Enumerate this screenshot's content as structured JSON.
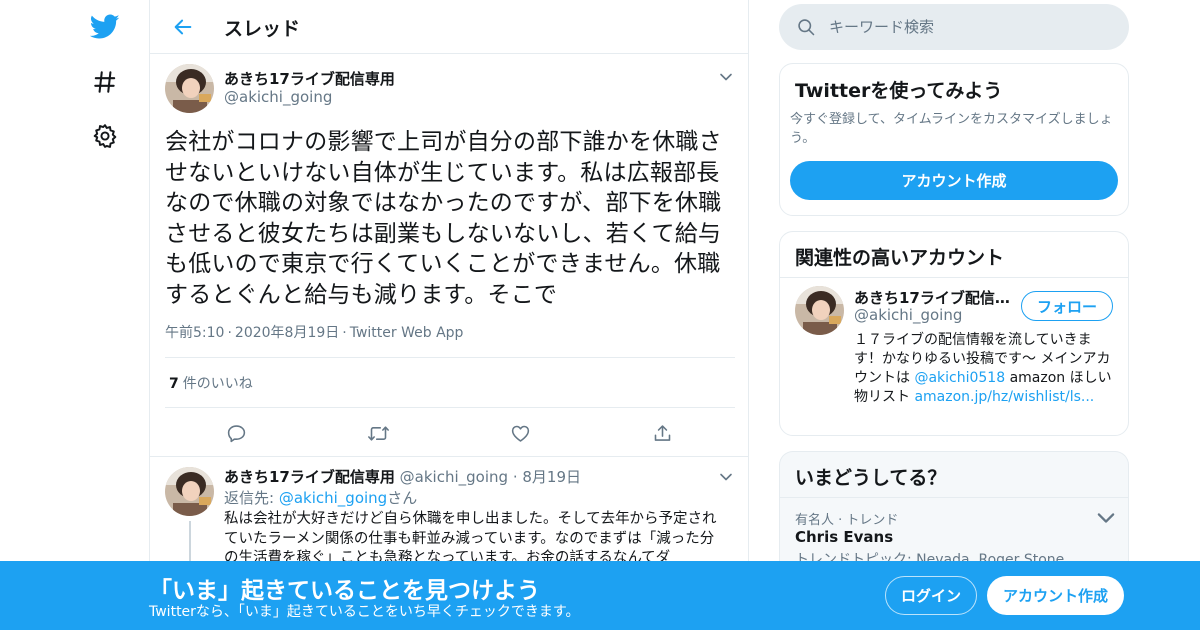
{
  "colors": {
    "accent": "#1da1f2",
    "text_primary": "#14171a",
    "text_secondary": "#657786",
    "border": "#e6ecf0"
  },
  "nav": {
    "icons": [
      "twitter-bird-icon",
      "hashtag-icon",
      "settings-gear-icon"
    ]
  },
  "header": {
    "title": "スレッド",
    "back_icon": "arrow-left-icon"
  },
  "main_tweet": {
    "display_name": "あきち17ライブ配信専用",
    "handle": "@akichi_going",
    "text": "会社がコロナの影響で上司が自分の部下誰かを休職させないといけない自体が生じています。私は広報部長なので休職の対象ではなかったのですが、部下を休職させると彼女たちは副業もしないないし、若くて給与も低いので東京で行くていくことができません。休職するとぐんと給与も減ります。そこで",
    "time": "午前5:10",
    "date": "2020年8月19日",
    "source": "Twitter Web App",
    "sep": "·",
    "likes_count": "7",
    "likes_label": "件のいいね"
  },
  "reply_tweet": {
    "display_name": "あきち17ライブ配信専用",
    "handle": "@akichi_going",
    "sep": "·",
    "date": "8月19日",
    "reply_to_prefix": "返信先: ",
    "reply_to_handle": "@akichi_going",
    "reply_to_suffix": "さん",
    "text": "私は会社が大好きだけど自ら休職を申し出ました。そして去年から予定されていたラーメン関係の仕事も軒並み減っています。なのでまずは「減った分の生活費を稼ぐ」ことも急務となっています。お金の話するなんてダ"
  },
  "search": {
    "placeholder": "キーワード検索"
  },
  "signup_card": {
    "title": "Twitterを使ってみよう",
    "description": "今すぐ登録して、タイムラインをカスタマイズしましょう。",
    "button": "アカウント作成"
  },
  "related_card": {
    "title": "関連性の高いアカウント",
    "display_name": "あきち17ライブ配信専用",
    "handle": "@akichi_going",
    "follow_label": "フォロー",
    "bio_part1": "１７ライブの配信情報を流していきます！かなりゆるい投稿です〜 メインアカウントは ",
    "bio_link1": "@akichi0518",
    "bio_part2": " amazon ほしい物リスト ",
    "bio_link2": "amazon.jp/hz/wishlist/ls..."
  },
  "trends_card": {
    "title": "いまどうしてる？",
    "trend_meta": "有名人 · トレンド",
    "trend_title": "Chris Evans",
    "trend_topics": "トレンドトピック: Nevada, Roger Stone"
  },
  "bottom_bar": {
    "title": "「いま」起きていることを見つけよう",
    "subtitle": "Twitterなら、「いま」起きていることをいち早くチェックできます。",
    "login": "ログイン",
    "signup": "アカウント作成"
  }
}
